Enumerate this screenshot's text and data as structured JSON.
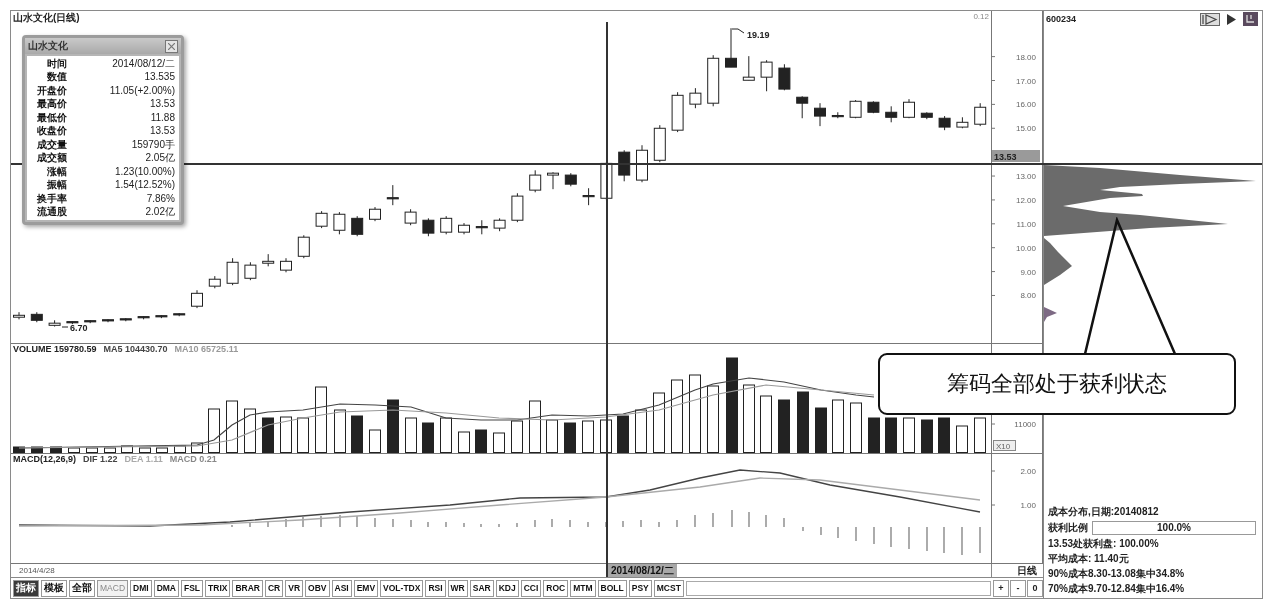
{
  "chart": {
    "title": "山水文化(日线)",
    "corner_label": "0.12",
    "high_marker": "19.19",
    "low_marker": "6.70",
    "chart_data": {
      "type": "candlestick",
      "ohlc": [
        [
          7.09,
          7.3,
          7.0,
          7.17
        ],
        [
          7.21,
          7.3,
          6.88,
          6.96
        ],
        [
          6.75,
          6.96,
          6.7,
          6.84
        ],
        [
          6.84,
          6.92,
          6.8,
          6.88
        ],
        [
          6.88,
          6.96,
          6.84,
          6.92
        ],
        [
          6.92,
          7.0,
          6.88,
          6.96
        ],
        [
          6.96,
          7.05,
          6.92,
          7.0
        ],
        [
          7.05,
          7.13,
          7.0,
          7.09
        ],
        [
          7.09,
          7.17,
          7.05,
          7.13
        ],
        [
          7.17,
          7.26,
          7.13,
          7.21
        ],
        [
          7.55,
          8.22,
          7.47,
          8.09
        ],
        [
          8.39,
          8.81,
          8.3,
          8.68
        ],
        [
          8.51,
          9.56,
          8.43,
          9.39
        ],
        [
          8.72,
          9.39,
          8.64,
          9.27
        ],
        [
          9.35,
          9.73,
          9.22,
          9.43
        ],
        [
          9.06,
          9.56,
          8.97,
          9.43
        ],
        [
          9.64,
          10.52,
          9.56,
          10.44
        ],
        [
          10.9,
          11.53,
          10.82,
          11.44
        ],
        [
          10.73,
          11.49,
          10.56,
          11.4
        ],
        [
          11.23,
          11.32,
          10.48,
          10.56
        ],
        [
          11.19,
          11.7,
          11.11,
          11.61
        ],
        [
          12.03,
          12.62,
          11.78,
          12.07
        ],
        [
          11.03,
          11.61,
          10.94,
          11.49
        ],
        [
          11.15,
          11.23,
          10.48,
          10.61
        ],
        [
          10.65,
          11.32,
          10.56,
          11.23
        ],
        [
          10.65,
          11.03,
          10.56,
          10.94
        ],
        [
          10.82,
          11.15,
          10.56,
          10.86
        ],
        [
          10.82,
          11.23,
          10.69,
          11.15
        ],
        [
          11.15,
          12.28,
          11.07,
          12.16
        ],
        [
          12.41,
          13.24,
          12.32,
          13.04
        ],
        [
          13.04,
          13.16,
          12.45,
          13.12
        ],
        [
          13.04,
          13.12,
          12.57,
          12.66
        ],
        [
          12.11,
          12.49,
          11.78,
          12.16
        ],
        [
          12.07,
          13.58,
          11.99,
          13.53
        ],
        [
          14.0,
          14.08,
          12.78,
          13.04
        ],
        [
          12.83,
          14.29,
          12.74,
          14.08
        ],
        [
          13.66,
          15.13,
          13.58,
          15.0
        ],
        [
          14.92,
          16.51,
          14.84,
          16.38
        ],
        [
          16.01,
          16.68,
          15.84,
          16.47
        ],
        [
          16.05,
          18.06,
          15.92,
          17.93
        ],
        [
          17.93,
          19.19,
          17.56,
          17.56
        ],
        [
          17.01,
          18.02,
          17.01,
          17.14
        ],
        [
          17.14,
          17.85,
          16.55,
          17.77
        ],
        [
          17.52,
          17.68,
          16.59,
          16.64
        ],
        [
          16.3,
          16.34,
          15.42,
          16.05
        ],
        [
          15.84,
          16.05,
          15.09,
          15.51
        ],
        [
          15.46,
          15.67,
          15.42,
          15.51
        ],
        [
          15.46,
          16.18,
          15.42,
          16.13
        ],
        [
          16.09,
          16.13,
          15.63,
          15.67
        ],
        [
          15.67,
          15.92,
          15.25,
          15.46
        ],
        [
          15.46,
          16.22,
          15.42,
          16.09
        ],
        [
          15.63,
          15.67,
          15.38,
          15.46
        ],
        [
          15.42,
          15.51,
          14.92,
          15.05
        ],
        [
          15.05,
          15.46,
          15.0,
          15.25
        ],
        [
          15.17,
          16.05,
          15.09,
          15.88
        ]
      ],
      "ylim": [
        6.01,
        19.91
      ],
      "yticks": [
        {
          "value": 18,
          "label": "18.00"
        },
        {
          "value": 17,
          "label": "17.00"
        },
        {
          "value": 16,
          "label": "16.00"
        },
        {
          "value": 15,
          "label": "15.00"
        },
        {
          "value": 13,
          "label": "13.00"
        },
        {
          "value": 12,
          "label": "12.00"
        },
        {
          "value": 11,
          "label": "11.00"
        },
        {
          "value": 10,
          "label": "10.00"
        },
        {
          "value": 9,
          "label": "9.00"
        },
        {
          "value": 8,
          "label": "8.00"
        }
      ]
    }
  },
  "price_axis": {
    "cursor_value": "13.53"
  },
  "info_popup": {
    "title": "山水文化",
    "rows": [
      {
        "label": "时间",
        "value": "2014/08/12/二"
      },
      {
        "label": "数值",
        "value": "13.535"
      },
      {
        "label": "开盘价",
        "value": "11.05(+2.00%)"
      },
      {
        "label": "最高价",
        "value": "13.53"
      },
      {
        "label": "最低价",
        "value": "11.88"
      },
      {
        "label": "收盘价",
        "value": "13.53"
      },
      {
        "label": "成交量",
        "value": "159790手"
      },
      {
        "label": "成交额",
        "value": "2.05亿"
      },
      {
        "label": "涨幅",
        "value": "1.23(10.00%)"
      },
      {
        "label": "振幅",
        "value": "1.54(12.52%)"
      },
      {
        "label": "换手率",
        "value": "7.86%"
      },
      {
        "label": "流通股",
        "value": "2.02亿"
      }
    ]
  },
  "volume_pane": {
    "legend": [
      {
        "text": "VOLUME 159780.59",
        "color": "#222222"
      },
      {
        "text": "MA5 104430.70",
        "color": "#444444"
      },
      {
        "text": "MA10 65725.11",
        "color": "#999999"
      }
    ],
    "axis_label": "11000",
    "unit": "X10"
  },
  "macd_pane": {
    "title": "MACD(12,26,9)",
    "legend": [
      {
        "text": "DIF 1.22",
        "color": "#444444"
      },
      {
        "text": "DEA 1.11",
        "color": "#aaaaaa"
      },
      {
        "text": "MACD 0.21",
        "color": "#888888"
      }
    ],
    "axis_labels": [
      "2.00",
      "1.00"
    ]
  },
  "date_bar": {
    "start_date": "2014/4/28",
    "cursor_date": "2014/08/12/二",
    "period": "日线"
  },
  "mode_tabs": [
    {
      "label": "指标",
      "selected": true
    },
    {
      "label": "模板",
      "selected": false
    },
    {
      "label": "全部",
      "selected": false
    }
  ],
  "indicator_tabs": [
    {
      "label": "MACD",
      "selected": true
    },
    {
      "label": "DMI",
      "selected": false
    },
    {
      "label": "DMA",
      "selected": false
    },
    {
      "label": "FSL",
      "selected": false
    },
    {
      "label": "TRIX",
      "selected": false
    },
    {
      "label": "BRAR",
      "selected": false
    },
    {
      "label": "CR",
      "selected": false
    },
    {
      "label": "VR",
      "selected": false
    },
    {
      "label": "OBV",
      "selected": false
    },
    {
      "label": "ASI",
      "selected": false
    },
    {
      "label": "EMV",
      "selected": false
    },
    {
      "label": "VOL-TDX",
      "selected": false
    },
    {
      "label": "RSI",
      "selected": false
    },
    {
      "label": "WR",
      "selected": false
    },
    {
      "label": "SAR",
      "selected": false
    },
    {
      "label": "KDJ",
      "selected": false
    },
    {
      "label": "CCI",
      "selected": false
    },
    {
      "label": "ROC",
      "selected": false
    },
    {
      "label": "MTM",
      "selected": false
    },
    {
      "label": "BOLL",
      "selected": false
    },
    {
      "label": "PSY",
      "selected": false
    },
    {
      "label": "MCST",
      "selected": false
    }
  ],
  "zoom_buttons": [
    "+",
    "-",
    "0"
  ],
  "cost_panel": {
    "code": "600234",
    "title": "成本分布,日期:20140812",
    "profit_ratio": {
      "label": "获利比例",
      "reading": "100.0%"
    },
    "lines": [
      "13.53处获利盘: 100.00%",
      "平均成本: 11.40元",
      "90%成本8.30-13.08集中34.8%",
      "70%成本9.70-12.84集中16.4%"
    ]
  },
  "callout": {
    "text": "筹码全部处于获利状态"
  }
}
